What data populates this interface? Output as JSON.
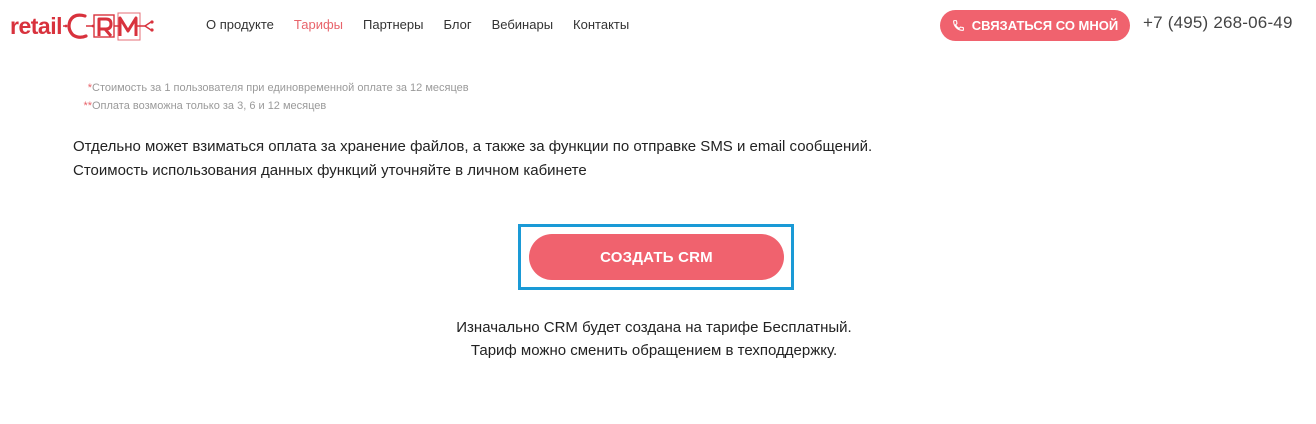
{
  "brand": {
    "logo_prefix": "retail",
    "logo_suffix": "CRM",
    "accent_color": "#f0626e",
    "highlight_color": "#1a9ad6"
  },
  "nav": {
    "items": [
      {
        "label": "О продукте",
        "active": false
      },
      {
        "label": "Тарифы",
        "active": true
      },
      {
        "label": "Партнеры",
        "active": false
      },
      {
        "label": "Блог",
        "active": false
      },
      {
        "label": "Вебинары",
        "active": false
      },
      {
        "label": "Контакты",
        "active": false
      }
    ]
  },
  "header": {
    "contact_button_label": "СВЯЗАТЬСЯ СО МНОЙ",
    "contact_button_icon": "phone-icon",
    "phone": "+7 (495) 268-06-49"
  },
  "footnotes": [
    {
      "mark": "*",
      "text": "Стоимость за 1 пользователя при единовременной оплате за 12 месяцев"
    },
    {
      "mark": "**",
      "text": "Оплата возможна только за 3, 6 и 12 месяцев"
    }
  ],
  "description": {
    "line1": "Отдельно может взиматься оплата за хранение файлов, а также за функции по отправке SMS и email сообщений.",
    "line2": "Стоимость использования данных функций уточняйте в личном кабинете"
  },
  "cta": {
    "label": "СОЗДАТЬ CRM"
  },
  "note": {
    "line1": "Изначально CRM будет создана на тарифе Бесплатный.",
    "line2": "Тариф можно сменить обращением в техподдержку."
  }
}
